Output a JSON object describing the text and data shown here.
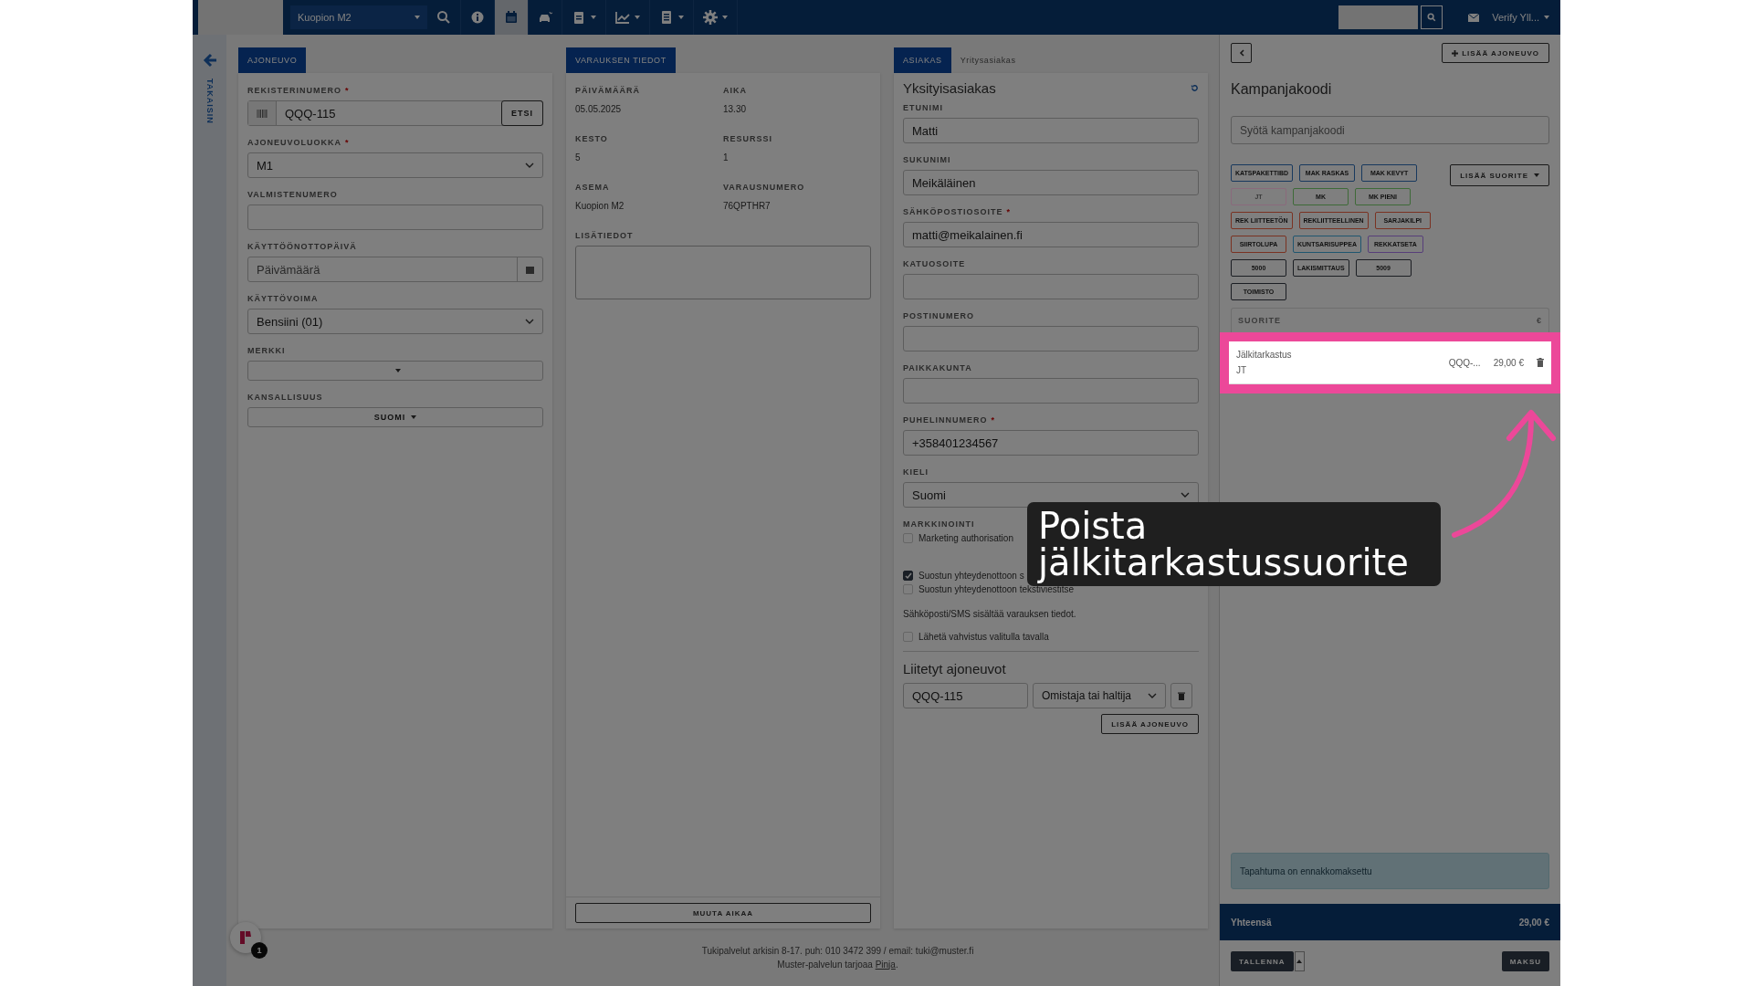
{
  "top_bar": {
    "location_select": "Kuopion M2",
    "tools": [
      {
        "kind": "search",
        "selected": false,
        "dropdown": false
      },
      {
        "kind": "info",
        "selected": false,
        "dropdown": false
      },
      {
        "kind": "calendar",
        "selected": true,
        "dropdown": false
      },
      {
        "kind": "car",
        "selected": false,
        "dropdown": false
      },
      {
        "kind": "clipboard",
        "selected": false,
        "dropdown": true
      },
      {
        "kind": "chart",
        "selected": false,
        "dropdown": true
      },
      {
        "kind": "document",
        "selected": false,
        "dropdown": true
      },
      {
        "kind": "gear",
        "selected": false,
        "dropdown": true
      }
    ],
    "user": "Verify Yll..."
  },
  "back_label": "TAKAISIN",
  "vehicle": {
    "tab": "AJONEUVO",
    "fields": [
      {
        "kind": "plate",
        "label": "REKISTERINUMERO",
        "required_mark": "*",
        "value": "QQQ-115",
        "button": "ETSI"
      },
      {
        "kind": "select",
        "label": "AJONEUVOLUOKKA",
        "required_mark": "*",
        "value": "M1"
      },
      {
        "kind": "input",
        "label": "VALMISTENUMERO"
      },
      {
        "kind": "date",
        "label": "KÄYTTÖÖNOTTOPÄIVÄ",
        "placeholder": "Päivämäärä"
      },
      {
        "kind": "select",
        "label": "KÄYTTÖVOIMA",
        "value": "Bensiini (01)"
      },
      {
        "kind": "dropdown",
        "label": "MERKKI"
      },
      {
        "kind": "dropdown",
        "label": "KANSALLISUUS",
        "value": "SUOMI"
      }
    ]
  },
  "reservation": {
    "tab": "VARAUKSEN TIEDOT",
    "info": [
      {
        "label": "PÄIVÄMÄÄRÄ",
        "value": "05.05.2025"
      },
      {
        "label": "AIKA",
        "value": "13.30"
      },
      {
        "label": "KESTO",
        "value": "5"
      },
      {
        "label": "RESURSSI",
        "value": "1"
      },
      {
        "label": "ASEMA",
        "value": "Kuopion M2"
      },
      {
        "label": "VARAUSNUMERO",
        "value": "76QPTHR7"
      }
    ],
    "notes_label": "LISÄTIEDOT",
    "change_time_button": "MUUTA AIKAA"
  },
  "customer": {
    "tabs": [
      {
        "label": "ASIAKAS",
        "selected": true
      },
      {
        "label": "Yritysasiakas",
        "selected": false
      }
    ],
    "heading": "Yksityisasiakas",
    "fields": [
      {
        "kind": "input",
        "label": "ETUNIMI",
        "value": "Matti"
      },
      {
        "kind": "input",
        "label": "SUKUNIMI",
        "value": "Meikäläinen"
      },
      {
        "kind": "input",
        "label": "SÄHKÖPOSTIOSOITE",
        "required_mark": "*",
        "value": "matti@meikalainen.fi"
      },
      {
        "kind": "input",
        "label": "KATUOSOITE"
      },
      {
        "kind": "input",
        "label": "POSTINUMERO"
      },
      {
        "kind": "input",
        "label": "PAIKKAKUNTA"
      },
      {
        "kind": "input",
        "label": "PUHELINNUMERO",
        "required_mark": "*",
        "value": "+358401234567"
      },
      {
        "kind": "select",
        "label": "KIELI",
        "value": "Suomi"
      }
    ],
    "marketing_label": "MARKKINOINTI",
    "marketing": {
      "label": "Marketing authorisation",
      "checked": false
    },
    "contact_options": [
      {
        "label": "Suostun yhteydenottoon s",
        "checked": true
      },
      {
        "label": "Suostun yhteydenottoon tekstiviestitse",
        "checked": false
      }
    ],
    "info_text": "Sähköposti/SMS sisältää varauksen tiedot.",
    "send_confirmation": {
      "label": "Lähetä vahvistus valitulla tavalla",
      "checked": false
    },
    "linked_heading": "Liitetyt ajoneuvot",
    "linked_vehicle": {
      "plate": "QQQ-115",
      "role": "Omistaja tai haltija"
    },
    "add_vehicle_button": "LISÄÄ AJONEUVO"
  },
  "side_panel": {
    "add_vehicle_button": "LISÄÄ AJONEUVO",
    "heading": "Kampanjakoodi",
    "code_placeholder": "Syötä kampanjakoodi",
    "tags": [
      {
        "label": "KATSPAKETTIBD",
        "color": "#18395e",
        "disabled": false
      },
      {
        "label": "MAK RASKAS",
        "color": "#18395e",
        "disabled": false
      },
      {
        "label": "MAK KEVYT",
        "color": "#18395e",
        "disabled": false
      },
      {
        "label": "JT",
        "color": "#8a6a7c",
        "disabled": true
      },
      {
        "label": "MK",
        "color": "#3e6a38",
        "disabled": false
      },
      {
        "label": "MK PIENI",
        "color": "#3e6a38",
        "disabled": false
      },
      {
        "label": "REK LIITTEETÖN",
        "color": "#7a3222",
        "disabled": false
      },
      {
        "label": "REKLIITTEELLINEN",
        "color": "#7a3222",
        "disabled": false
      },
      {
        "label": "SARJAKILPI",
        "color": "#7a3222",
        "disabled": false
      },
      {
        "label": "SIIRTOLUPA",
        "color": "#7a3222",
        "disabled": false
      },
      {
        "label": "KUNTSARISUPPEA",
        "color": "#1f5670",
        "disabled": false
      },
      {
        "label": "REKKATSETA",
        "color": "#573e7a",
        "disabled": false
      },
      {
        "label": "5000",
        "color": "#1b1e23",
        "disabled": false
      },
      {
        "label": "LAKISMITTAUS",
        "color": "#1b1e23",
        "disabled": false
      },
      {
        "label": "5009",
        "color": "#1b1e23",
        "disabled": false
      },
      {
        "label": "TOIMISTO",
        "color": "#1b1e23",
        "disabled": false
      }
    ],
    "add_service_button": "LISÄÄ SUORITE",
    "table_columns": [
      "SUORITE",
      "€"
    ],
    "rows": [
      {
        "name": "Jälkitarkastus",
        "code": "JT",
        "vehicle": "QQQ-...",
        "price": "29,00 €",
        "highlighted": true
      }
    ],
    "notice": "Tapahtuma on ennakkomaksettu",
    "total_label": "Yhteensä",
    "total_value": "29,00 €",
    "save_button": "TALLENNA",
    "pay_button": "MAKSU"
  },
  "footer": {
    "support": "Tukipalvelut arkisin 8-17. puh: 010 3472 399 / email: tuki@muster.fi",
    "provider": "Muster-palvelun tarjoaa",
    "provider_link": "Pinja",
    "provider_end": "."
  },
  "chat": {
    "badge": "1"
  },
  "callout": {
    "text": "Poista jälkitarkastussuorite"
  }
}
